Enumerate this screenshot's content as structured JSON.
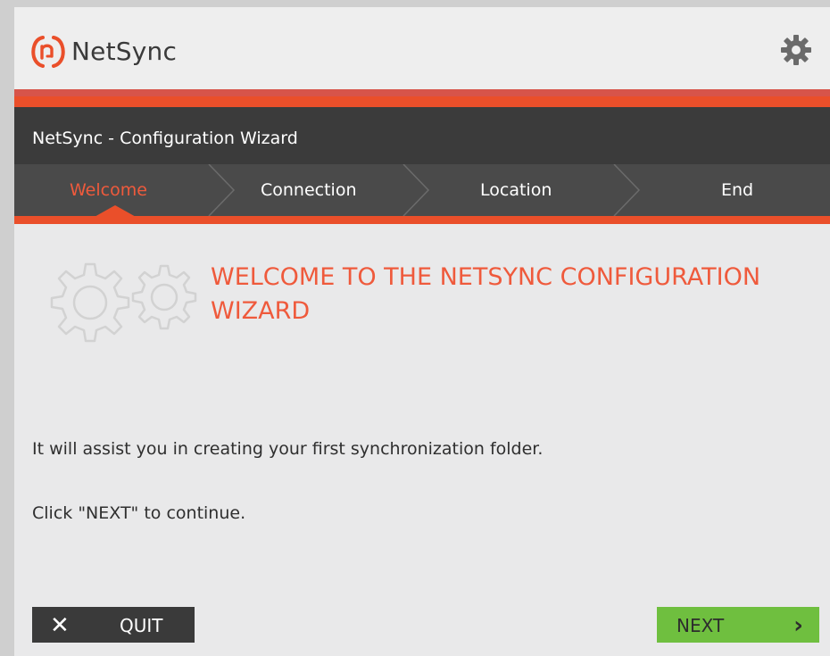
{
  "header": {
    "app_name": "NetSync"
  },
  "titlebar": {
    "title": "NetSync - Configuration Wizard"
  },
  "steps": [
    {
      "label": "Welcome",
      "active": true
    },
    {
      "label": "Connection",
      "active": false
    },
    {
      "label": "Location",
      "active": false
    },
    {
      "label": "End",
      "active": false
    }
  ],
  "content": {
    "heading": "WELCOME TO THE NETSYNC CONFIGURATION WIZARD",
    "line1": "It will assist you in creating your first synchronization folder.",
    "line2": "Click \"NEXT\" to continue."
  },
  "buttons": {
    "quit_icon": "✕",
    "quit_label": "QUIT",
    "next_label": "NEXT",
    "next_icon": "›"
  },
  "colors": {
    "accent": "#ea4f2a",
    "title_bar": "#3b3b3b",
    "next_button": "#6fbf3f",
    "quit_button": "#3a3a3a"
  },
  "icons": [
    "netsync-logo-icon",
    "gear-icon",
    "gears-illustration-icon",
    "close-icon",
    "chevron-right-icon"
  ]
}
